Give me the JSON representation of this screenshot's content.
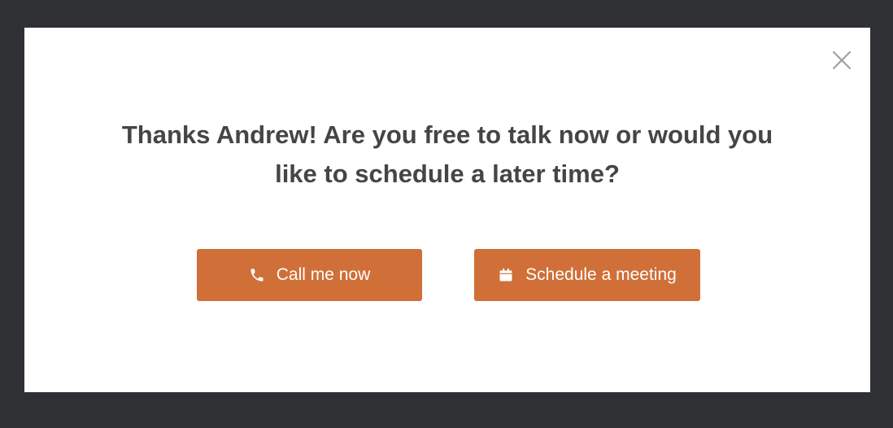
{
  "dialog": {
    "message": "Thanks Andrew! Are you free to talk now or would you like to schedule a later time?",
    "close_icon": "close-icon"
  },
  "actions": {
    "call": {
      "label": "Call me now",
      "icon": "phone-icon"
    },
    "schedule": {
      "label": "Schedule a meeting",
      "icon": "calendar-icon"
    }
  },
  "colors": {
    "backdrop": "#2f3033",
    "modal_background": "#ffffff",
    "text": "#454545",
    "accent": "#d06f38",
    "close_icon": "#a0a0a0"
  }
}
